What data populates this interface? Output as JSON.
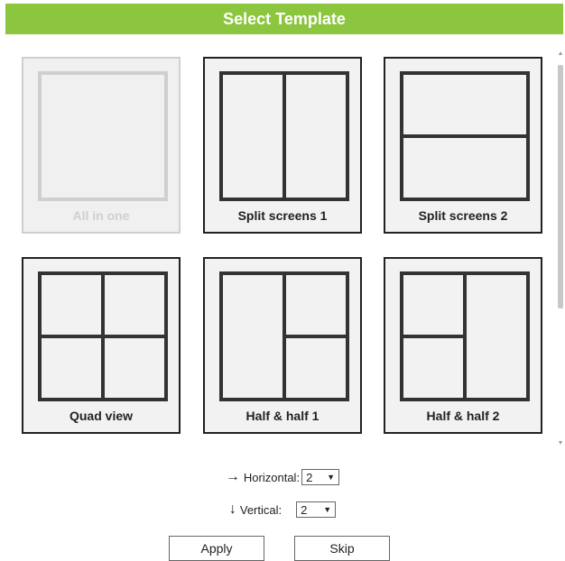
{
  "header": {
    "title": "Select Template"
  },
  "templates": [
    {
      "label": "All in one",
      "disabled": true
    },
    {
      "label": "Split screens 1",
      "disabled": false
    },
    {
      "label": "Split screens 2",
      "disabled": false
    },
    {
      "label": "Quad view",
      "disabled": false
    },
    {
      "label": "Half & half 1",
      "disabled": false
    },
    {
      "label": "Half & half 2",
      "disabled": false
    }
  ],
  "controls": {
    "horizontal": {
      "arrow": "→",
      "label": "Horizontal:",
      "value": "2"
    },
    "vertical": {
      "arrow": "↓",
      "label": "Vertical:",
      "value": "2"
    }
  },
  "buttons": {
    "apply": "Apply",
    "skip": "Skip"
  },
  "icons": {
    "scroll_up": "scroll-up-arrow-icon",
    "scroll_down": "scroll-down-arrow-icon",
    "dropdown": "caret-down-icon"
  },
  "colors": {
    "header_bg": "#8cc63f",
    "card_bg": "#f2f2f2",
    "card_border": "#222222",
    "disabled": "#cfcfcf"
  }
}
